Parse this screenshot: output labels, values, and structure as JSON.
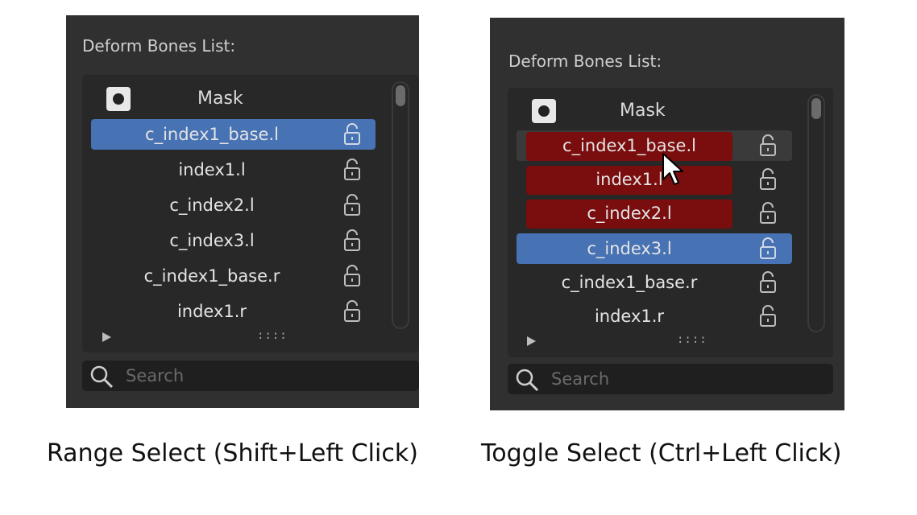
{
  "panels": {
    "left": {
      "title": "Deform Bones List:",
      "mask_label": "Mask",
      "rows": [
        {
          "label": "c_index1_base.l",
          "state": "active"
        },
        {
          "label": "index1.l",
          "state": "normal"
        },
        {
          "label": "c_index2.l",
          "state": "normal"
        },
        {
          "label": "c_index3.l",
          "state": "normal"
        },
        {
          "label": "c_index1_base.r",
          "state": "normal"
        },
        {
          "label": "index1.r",
          "state": "normal"
        }
      ],
      "grip": "::::",
      "search_placeholder": "Search"
    },
    "right": {
      "title": "Deform Bones List:",
      "mask_label": "Mask",
      "rows": [
        {
          "label": "c_index1_base.l",
          "state": "toggled"
        },
        {
          "label": "index1.l",
          "state": "toggled"
        },
        {
          "label": "c_index2.l",
          "state": "toggled"
        },
        {
          "label": "c_index3.l",
          "state": "active"
        },
        {
          "label": "c_index1_base.r",
          "state": "normal"
        },
        {
          "label": "index1.r",
          "state": "normal"
        }
      ],
      "grip": "::::",
      "search_placeholder": "Search"
    }
  },
  "captions": {
    "left": "Range Select (Shift+Left Click)",
    "right": "Toggle Select (Ctrl+Left Click)"
  },
  "colors": {
    "panel_bg": "#303030",
    "list_bg": "#282828",
    "active_row": "#4772b3",
    "toggled_row": "#7a0d0d"
  },
  "icons": {
    "row_icon": "unlock-icon",
    "search": "search-icon",
    "cursor": "mouse-pointer-icon"
  }
}
